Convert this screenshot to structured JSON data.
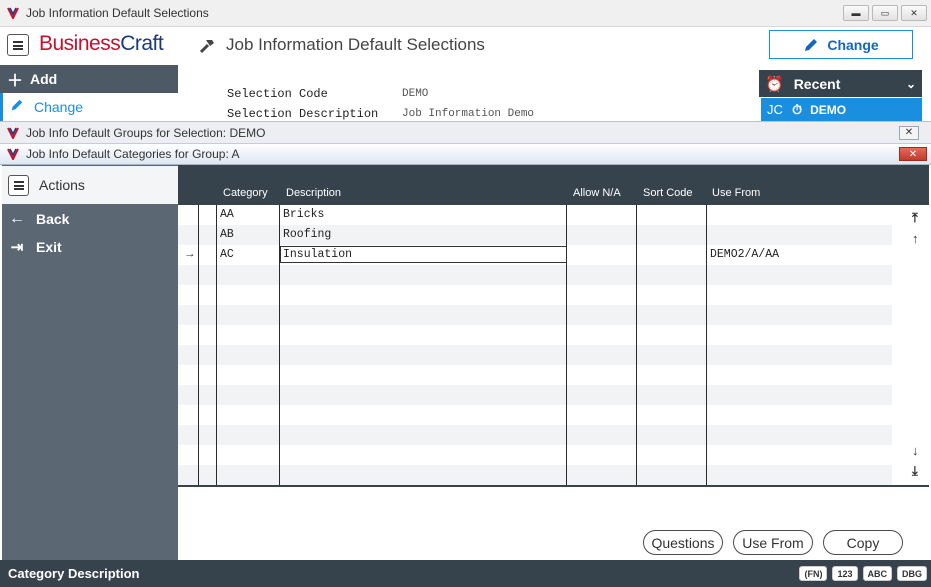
{
  "window": {
    "title": "Job Information Default Selections"
  },
  "header": {
    "brand_a": "Business",
    "brand_b": "Craft",
    "page_title": "Job Information Default Selections",
    "change_label": "Change"
  },
  "nav": {
    "add_label": "Add",
    "change_label": "Change"
  },
  "selection": {
    "code_label": "Selection Code",
    "code_value": "DEMO",
    "desc_label": "Selection Description",
    "desc_value": "Job Information Demo"
  },
  "recent": {
    "label": "Recent",
    "badge": "JC",
    "item": "DEMO"
  },
  "groups_window": {
    "title": "Job Info Default Groups for Selection: DEMO"
  },
  "categories_window": {
    "title": "Job Info Default Categories for Group: A"
  },
  "sidebar": {
    "actions_label": "Actions",
    "back_label": "Back",
    "exit_label": "Exit"
  },
  "grid": {
    "columns": [
      "Category",
      "Description",
      "Allow N/A",
      "Sort Code",
      "Use From"
    ],
    "rows": [
      {
        "category": "AA",
        "description": "Bricks",
        "allow_na": "",
        "sort_code": "",
        "use_from": ""
      },
      {
        "category": "AB",
        "description": "Roofing",
        "allow_na": "",
        "sort_code": "",
        "use_from": ""
      },
      {
        "category": "AC",
        "description": "Insulation",
        "allow_na": "",
        "sort_code": "",
        "use_from": "DEMO2/A/AA"
      }
    ],
    "current_row_marker": "→"
  },
  "buttons": {
    "questions": "Questions",
    "use_from": "Use From",
    "copy": "Copy"
  },
  "status": {
    "text": "Category Description",
    "badges": [
      "(FN)",
      "123",
      "ABC",
      "DBG"
    ]
  },
  "colors": {
    "accent": "#1a8fe0",
    "dark": "#36424c",
    "sidebar": "#5b6873",
    "brand_red": "#c8102e",
    "brand_blue": "#1a3a7a"
  }
}
